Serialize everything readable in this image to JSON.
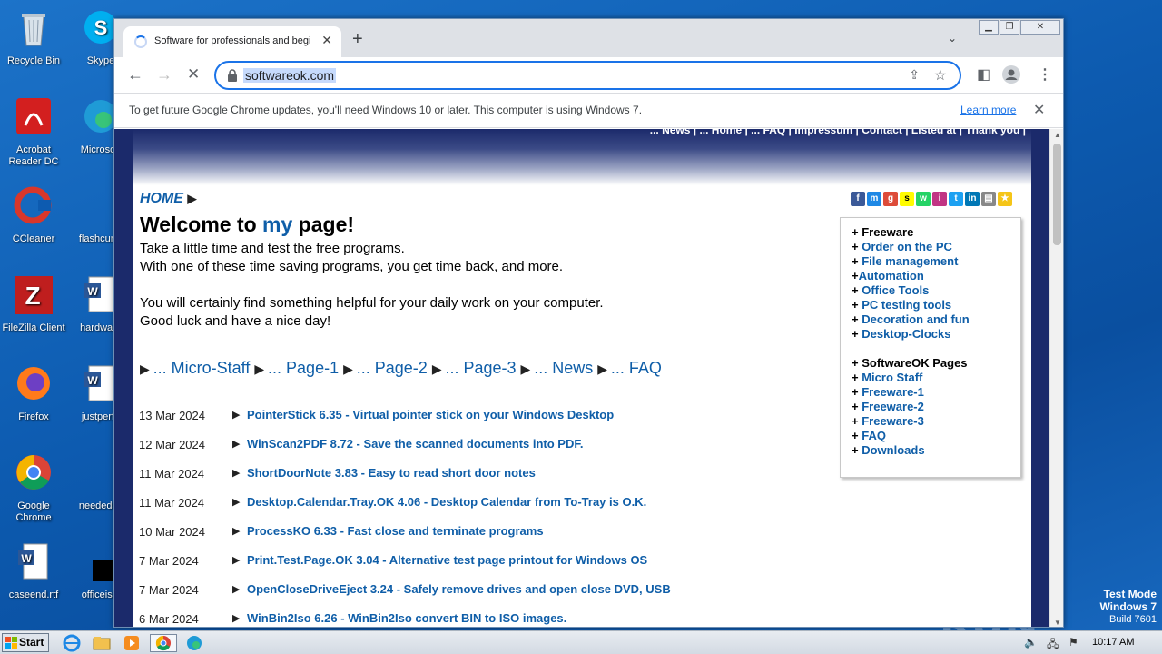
{
  "desktop": {
    "icons": [
      {
        "label": "Recycle Bin"
      },
      {
        "label": "Skype"
      },
      {
        "label": "Acrobat Reader DC"
      },
      {
        "label": "Microsoft"
      },
      {
        "label": "CCleaner"
      },
      {
        "label": "flashcurre"
      },
      {
        "label": "FileZilla Client"
      },
      {
        "label": "hardware"
      },
      {
        "label": "Firefox"
      },
      {
        "label": "justperfe"
      },
      {
        "label": "Google Chrome"
      },
      {
        "label": "neededse"
      },
      {
        "label": "caseend.rtf"
      },
      {
        "label": "officeisla"
      }
    ],
    "watermark": "ANY RUN",
    "test_mode": {
      "line1": "Test Mode",
      "line2": "Windows 7",
      "line3": "Build 7601"
    }
  },
  "browser": {
    "tab_title": "Software for professionals and begi",
    "url": "softwareok.com",
    "infobar_message": "To get future Google Chrome updates, you'll need Windows 10 or later. This computer is using Windows 7.",
    "infobar_link": "Learn more"
  },
  "page": {
    "top_links": "... News | ... Home | ... FAQ | Impressum | Contact | Listed at | Thank you |",
    "breadcrumb": "HOME",
    "welcome_prefix": "Welcome to ",
    "welcome_my": "my",
    "welcome_suffix": " page!",
    "intro_lines": [
      "Take a little time and test the free programs.",
      "With one of these time saving programs, you get time back, and more.",
      "You will certainly find something helpful for your daily work on your computer.",
      "Good luck and have a nice day!"
    ],
    "nav_links": [
      "... Micro-Staff",
      "... Page-1",
      "... Page-2",
      "... Page-3",
      "... News",
      "... FAQ"
    ],
    "news": [
      {
        "date": "13 Mar 2024",
        "title": "PointerStick 6.35 - Virtual pointer stick on your Windows Desktop"
      },
      {
        "date": "12 Mar 2024",
        "title": "WinScan2PDF 8.72 - Save the scanned documents into PDF."
      },
      {
        "date": "11 Mar 2024",
        "title": "ShortDoorNote 3.83 - Easy to read short door notes"
      },
      {
        "date": "11 Mar 2024",
        "title": "Desktop.Calendar.Tray.OK 4.06 - Desktop Calendar from To-Tray is O.K."
      },
      {
        "date": "10 Mar 2024",
        "title": "ProcessKO 6.33 - Fast close and terminate programs"
      },
      {
        "date": "7 Mar 2024",
        "title": "Print.Test.Page.OK 3.04 - Alternative test page printout for Windows OS"
      },
      {
        "date": "7 Mar 2024",
        "title": "OpenCloseDriveEject 3.24 - Safely remove drives and open close DVD, USB"
      },
      {
        "date": "6 Mar 2024",
        "title": "WinBin2Iso 6.26 - WinBin2Iso convert BIN to ISO images."
      }
    ],
    "sidebar_freeware": {
      "heading": "Freeware",
      "items": [
        "Order on the PC",
        "File management",
        "Automation",
        "Office Tools",
        "PC testing tools",
        "Decoration and fun",
        "Desktop-Clocks"
      ]
    },
    "sidebar_pages": {
      "heading": "SoftwareOK Pages",
      "items": [
        "Micro Staff",
        "Freeware-1",
        "Freeware-2",
        "Freeware-3",
        "FAQ",
        "Downloads"
      ]
    },
    "social_icons": [
      "facebook-icon",
      "messenger-icon",
      "google-plus-icon",
      "snapchat-icon",
      "whatsapp-icon",
      "instagram-icon",
      "twitter-icon",
      "linkedin-icon",
      "print-icon",
      "bookmark-star-icon"
    ]
  },
  "taskbar": {
    "start_label": "Start",
    "clock": "10:17 AM"
  },
  "colors": {
    "link_blue": "#0f5ea8",
    "page_frame": "#1b2a6b",
    "chrome_accent": "#1a73e8"
  }
}
